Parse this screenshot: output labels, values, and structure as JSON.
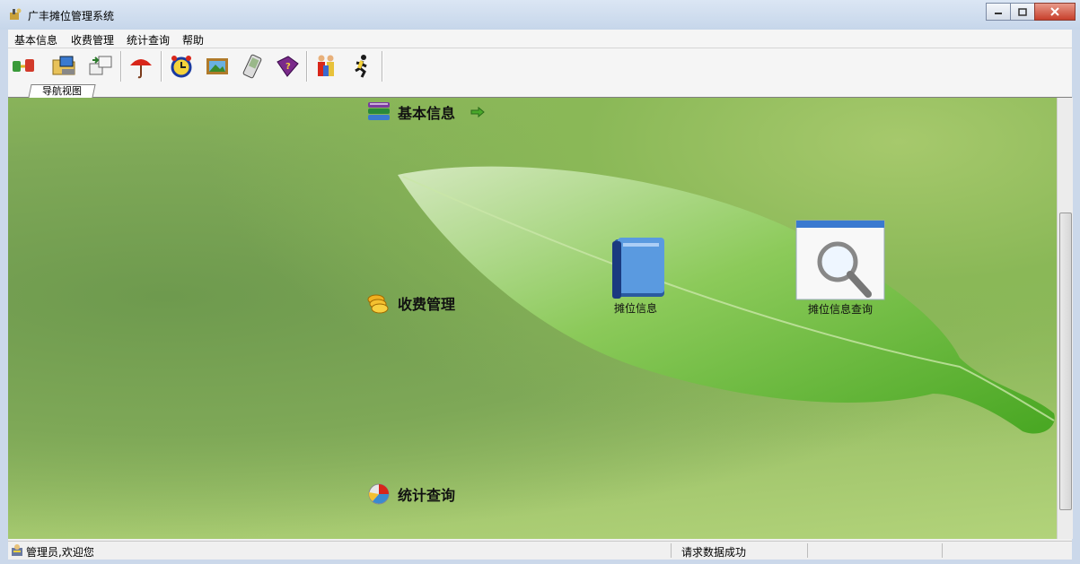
{
  "window": {
    "title": "广丰摊位管理系统"
  },
  "menu": {
    "items": [
      "基本信息",
      "收费管理",
      "统计查询",
      "帮助"
    ]
  },
  "toolbar": {
    "icons": [
      "connect-icon",
      "folder-computer-icon",
      "transfer-icon",
      "umbrella-icon",
      "alarm-clock-icon",
      "picture-icon",
      "pda-icon",
      "help-book-icon",
      "users-icon",
      "running-man-icon"
    ]
  },
  "tab": {
    "label": "导航视图"
  },
  "nav": {
    "categories": [
      {
        "label": "基本信息",
        "icon": "books-stack-icon"
      },
      {
        "label": "收费管理",
        "icon": "coins-icon"
      },
      {
        "label": "统计查询",
        "icon": "pie-chart-icon"
      }
    ],
    "items": [
      {
        "label": "摊位信息",
        "icon": "blue-book-icon"
      },
      {
        "label": "摊位信息查询",
        "icon": "magnifier-window-icon"
      }
    ]
  },
  "status": {
    "left": "管理员,欢迎您",
    "middle": "请求数据成功"
  },
  "colors": {
    "background_green": "#8ab857",
    "leaf_green": "#5fb52c"
  }
}
